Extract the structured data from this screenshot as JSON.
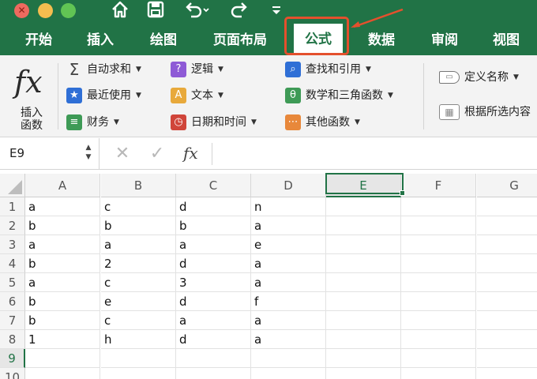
{
  "toolbar": {
    "home_icon": "home-icon",
    "save_icon": "save-icon",
    "undo_icon": "undo-icon",
    "redo_icon": "redo-icon",
    "customize_icon": "customize-quick-access-icon",
    "close_glyph": "✕"
  },
  "tabs": [
    {
      "label": "开始"
    },
    {
      "label": "插入"
    },
    {
      "label": "绘图"
    },
    {
      "label": "页面布局"
    },
    {
      "label": "公式"
    },
    {
      "label": "数据"
    },
    {
      "label": "审阅"
    },
    {
      "label": "视图"
    }
  ],
  "active_tab": "公式",
  "annotation": {
    "color": "#e4502d"
  },
  "ribbon": {
    "insert_function_label": "插入\n函数",
    "col1": [
      {
        "label": "自动求和",
        "icon": "sigma-icon"
      },
      {
        "label": "最近使用",
        "icon": "star-icon"
      },
      {
        "label": "财务",
        "icon": "finance-icon"
      }
    ],
    "col2": [
      {
        "label": "逻辑",
        "icon": "question-icon"
      },
      {
        "label": "文本",
        "icon": "text-a-icon"
      },
      {
        "label": "日期和时间",
        "icon": "clock-icon"
      }
    ],
    "col3": [
      {
        "label": "查找和引用",
        "icon": "lookup-icon"
      },
      {
        "label": "数学和三角函数",
        "icon": "theta-icon"
      },
      {
        "label": "其他函数",
        "icon": "more-icon"
      }
    ],
    "col4": [
      {
        "label": "定义名称",
        "icon": "tag-icon"
      },
      {
        "label": "根据所选内容",
        "icon": "table-icon"
      }
    ]
  },
  "formula_bar": {
    "name_box": "E9",
    "cancel": "✕",
    "enter": "✓",
    "fx": "fx",
    "value": ""
  },
  "sheet": {
    "columns": [
      "A",
      "B",
      "C",
      "D",
      "E",
      "F",
      "G"
    ],
    "selected_column": "E",
    "rows": [
      "1",
      "2",
      "3",
      "4",
      "5",
      "6",
      "7",
      "8",
      "9",
      "10"
    ],
    "selected_row": "9",
    "data": [
      [
        "a",
        "c",
        "d",
        "n"
      ],
      [
        "b",
        "b",
        "b",
        "a"
      ],
      [
        "a",
        "a",
        "a",
        "e"
      ],
      [
        "b",
        "2",
        "d",
        "a"
      ],
      [
        "a",
        "c",
        "3",
        "a"
      ],
      [
        "b",
        "e",
        "d",
        "f"
      ],
      [
        "b",
        "c",
        "a",
        "a"
      ],
      [
        "1",
        "h",
        "d",
        "a"
      ]
    ]
  },
  "colors": {
    "brand": "#217346",
    "ribbon_bg": "#f3f3f3"
  }
}
